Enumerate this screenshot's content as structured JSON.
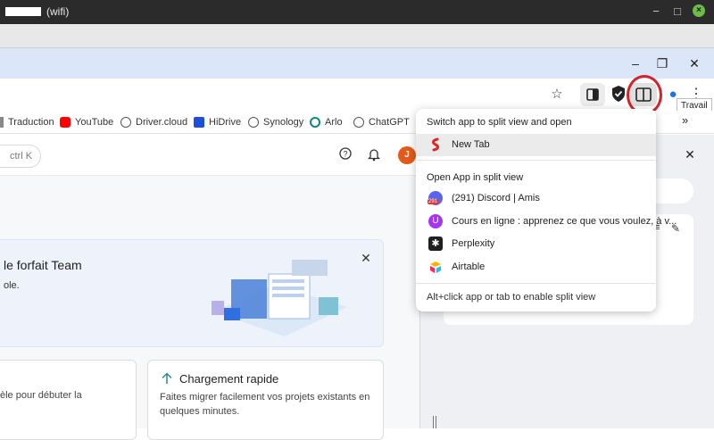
{
  "os": {
    "window_title": "(wifi)"
  },
  "tooltip": "Travail",
  "bookmarks": [
    {
      "label": "Traduction"
    },
    {
      "label": "YouTube"
    },
    {
      "label": "Driver.cloud"
    },
    {
      "label": "HiDrive"
    },
    {
      "label": "Synology"
    },
    {
      "label": "Arlo"
    },
    {
      "label": "ChatGPT"
    }
  ],
  "page": {
    "search_hint": "ctrl K",
    "avatar_initial": "J",
    "banner_title": "le forfait Team",
    "banner_sub": "ole.",
    "card1_text": "èle pour débuter la",
    "card2_title": "Chargement rapide",
    "card2_text": "Faites migrer facilement vos projets existants en quelques minutes."
  },
  "menu": {
    "switch_header": "Switch app to split view and open",
    "switch_items": [
      {
        "label": "New Tab",
        "icon": "new-tab-icon"
      }
    ],
    "open_header": "Open App in split view",
    "apps": [
      {
        "label": "(291) Discord | Amis",
        "icon": "discord-icon",
        "color": "#5865f2"
      },
      {
        "label": "Cours en ligne  : apprenez ce que vous voulez, à v...",
        "icon": "udemy-icon",
        "color": "#a435f0"
      },
      {
        "label": "Perplexity",
        "icon": "perplexity-icon",
        "color": "#1f1f1f"
      },
      {
        "label": "Airtable",
        "icon": "airtable-icon",
        "color": "#fcb400"
      }
    ],
    "footer": "Alt+click app or tab to enable split view"
  },
  "colors": {
    "accent_red": "#d2232a",
    "chrome_blue": "#dbe6f9"
  }
}
